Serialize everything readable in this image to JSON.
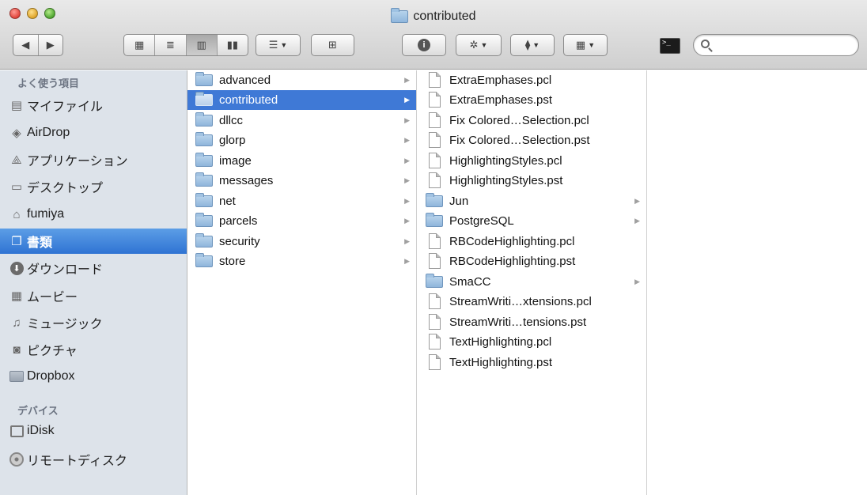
{
  "window": {
    "title": "contributed",
    "colors": {
      "selection": "#3f79d6",
      "sidebar_bg": "#dde3ea"
    }
  },
  "toolbar": {
    "nav_back_icon": "back-arrow-icon",
    "nav_forward_icon": "forward-arrow-icon",
    "view_modes": [
      {
        "name": "icon-view",
        "glyph": "▦"
      },
      {
        "name": "list-view",
        "glyph": "≣"
      },
      {
        "name": "column-view",
        "glyph": "▥"
      },
      {
        "name": "coverflow-view",
        "glyph": "▮▮"
      }
    ],
    "arrange_glyph": "☰",
    "new_folder_glyph": "⊞",
    "info_glyph": "i",
    "action_glyph": "✲",
    "dropbox_glyph": "⧫",
    "columns_glyph": "▦",
    "terminal_glyph": ">_",
    "search_placeholder": ""
  },
  "sidebar": {
    "favorites_header": "よく使う項目",
    "favorites": [
      {
        "label": "マイファイル",
        "icon": "all-my-files-icon",
        "glyph": "▤"
      },
      {
        "label": "AirDrop",
        "icon": "airdrop-icon",
        "glyph": "◈"
      },
      {
        "label": "アプリケーション",
        "icon": "applications-icon",
        "glyph": "⟁"
      },
      {
        "label": "デスクトップ",
        "icon": "desktop-icon",
        "glyph": "▭"
      },
      {
        "label": "fumiya",
        "icon": "home-icon",
        "glyph": "⌂"
      },
      {
        "label": "書類",
        "icon": "documents-icon",
        "glyph": "❐",
        "selected": true
      },
      {
        "label": "ダウンロード",
        "icon": "downloads-icon",
        "glyph": "⬇"
      },
      {
        "label": "ムービー",
        "icon": "movies-icon",
        "glyph": "▦"
      },
      {
        "label": "ミュージック",
        "icon": "music-icon",
        "glyph": "♫"
      },
      {
        "label": "ピクチャ",
        "icon": "pictures-icon",
        "glyph": "◙"
      },
      {
        "label": "Dropbox",
        "icon": "dropbox-folder-icon",
        "glyph": ""
      }
    ],
    "devices_header": "デバイス",
    "devices": [
      {
        "label": "iDisk",
        "icon": "idisk-icon",
        "glyph": "⏏"
      },
      {
        "label": "リモートディスク",
        "icon": "remote-disc-icon",
        "glyph": "◎"
      }
    ]
  },
  "column1": {
    "items": [
      {
        "label": "advanced",
        "kind": "folder"
      },
      {
        "label": "contributed",
        "kind": "folder",
        "selected": true
      },
      {
        "label": "dllcc",
        "kind": "folder"
      },
      {
        "label": "glorp",
        "kind": "folder"
      },
      {
        "label": "image",
        "kind": "folder"
      },
      {
        "label": "messages",
        "kind": "folder"
      },
      {
        "label": "net",
        "kind": "folder"
      },
      {
        "label": "parcels",
        "kind": "folder"
      },
      {
        "label": "security",
        "kind": "folder"
      },
      {
        "label": "store",
        "kind": "folder"
      }
    ]
  },
  "column2": {
    "items": [
      {
        "label": "ExtraEmphases.pcl",
        "kind": "file"
      },
      {
        "label": "ExtraEmphases.pst",
        "kind": "file"
      },
      {
        "label": "Fix Colored…Selection.pcl",
        "kind": "file"
      },
      {
        "label": "Fix Colored…Selection.pst",
        "kind": "file"
      },
      {
        "label": "HighlightingStyles.pcl",
        "kind": "file"
      },
      {
        "label": "HighlightingStyles.pst",
        "kind": "file"
      },
      {
        "label": "Jun",
        "kind": "folder"
      },
      {
        "label": "PostgreSQL",
        "kind": "folder"
      },
      {
        "label": "RBCodeHighlighting.pcl",
        "kind": "file"
      },
      {
        "label": "RBCodeHighlighting.pst",
        "kind": "file"
      },
      {
        "label": "SmaCC",
        "kind": "folder"
      },
      {
        "label": "StreamWriti…xtensions.pcl",
        "kind": "file"
      },
      {
        "label": "StreamWriti…tensions.pst",
        "kind": "file"
      },
      {
        "label": "TextHighlighting.pcl",
        "kind": "file"
      },
      {
        "label": "TextHighlighting.pst",
        "kind": "file"
      }
    ]
  },
  "glyphs": {
    "disclosure_arrow": "▶"
  }
}
